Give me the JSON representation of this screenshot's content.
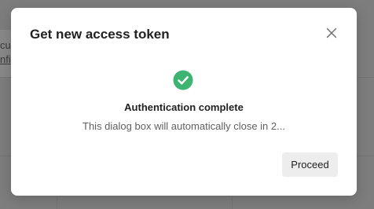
{
  "background": {
    "line1": "cu",
    "line2": "nfig"
  },
  "dialog": {
    "title": "Get new access token",
    "close_icon": "close-icon",
    "status_icon": "check-circle-icon",
    "status_title": "Authentication complete",
    "status_message": "This dialog box will automatically close in 2...",
    "proceed_label": "Proceed"
  },
  "colors": {
    "success": "#3db472",
    "overlay": "#7d7d7d",
    "button_bg": "#ededed"
  }
}
